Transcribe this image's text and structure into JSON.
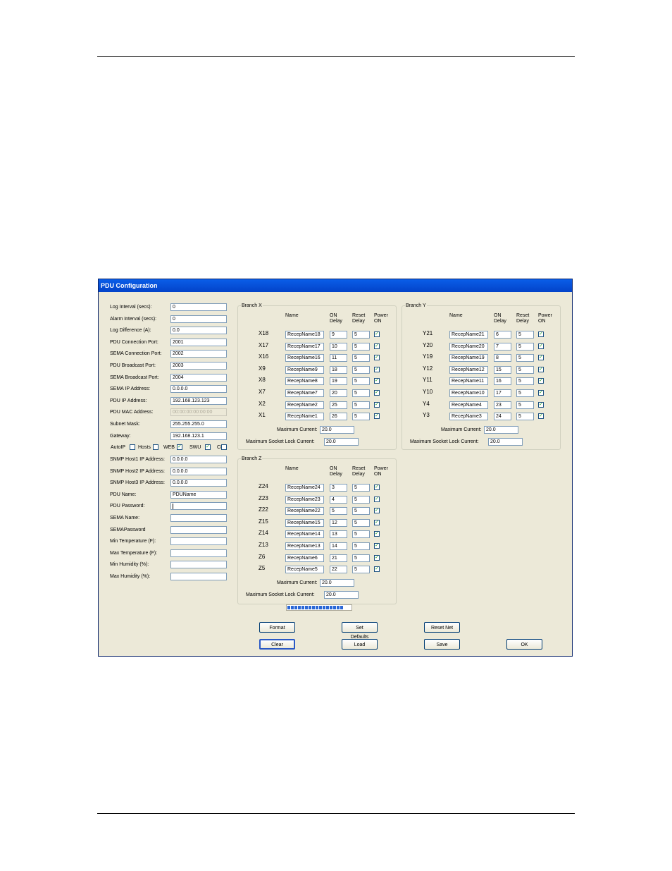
{
  "window": {
    "title": "PDU Configuration"
  },
  "left_fields": [
    {
      "label": "Log Interval (secs):",
      "value": "0",
      "state": "normal"
    },
    {
      "label": "Alarm Interval (secs):",
      "value": "0",
      "state": "normal"
    },
    {
      "label": "Log Difference (A):",
      "value": "0.0",
      "state": "normal"
    },
    {
      "label": "PDU Connection Port:",
      "value": "2001",
      "state": "normal"
    },
    {
      "label": "SEMA Connection Port:",
      "value": "2002",
      "state": "normal"
    },
    {
      "label": "PDU Broadcast Port:",
      "value": "2003",
      "state": "normal"
    },
    {
      "label": "SEMA Broadcast Port:",
      "value": "2004",
      "state": "normal"
    },
    {
      "label": "SEMA IP Address:",
      "value": "0.0.0.0",
      "state": "normal"
    },
    {
      "label": "PDU IP Address:",
      "value": "192.168.123.123",
      "state": "normal"
    },
    {
      "label": "PDU MAC Address:",
      "value": "00:00:00:00:00:00",
      "state": "disabled"
    },
    {
      "label": "Subnet Mask:",
      "value": "255.255.255.0",
      "state": "normal"
    },
    {
      "label": "Gateway:",
      "value": "192.168.123.1",
      "state": "normal"
    }
  ],
  "options": [
    {
      "label": "AutoIP",
      "checked": false
    },
    {
      "label": "Hosts",
      "checked": false
    },
    {
      "label": "WEB",
      "checked": true
    },
    {
      "label": "SWU",
      "checked": true
    },
    {
      "label": "CI",
      "checked": false
    }
  ],
  "left_fields2": [
    {
      "label": "SNMP Host1 IP Address:",
      "value": "0.0.0.0"
    },
    {
      "label": "SNMP Host2 IP Address:",
      "value": "0.0.0.0"
    },
    {
      "label": "SNMP Host3 IP Address:",
      "value": "0.0.0.0"
    },
    {
      "label": "PDU Name:",
      "value": "PDUName"
    },
    {
      "label": "PDU Password:",
      "value": ""
    },
    {
      "label": "SEMA Name:",
      "value": ""
    },
    {
      "label": "SEMAPassword",
      "value": ""
    },
    {
      "label": "Min Temperature (F):",
      "value": ""
    },
    {
      "label": "Max Temperature (F):",
      "value": ""
    },
    {
      "label": "Min Humidity (%):",
      "value": ""
    },
    {
      "label": "Max Humidity (%):",
      "value": ""
    }
  ],
  "column_headers": {
    "name": "Name",
    "on_delay": [
      "ON",
      "Delay"
    ],
    "reset_delay": [
      "Reset",
      "Delay"
    ],
    "power_on": [
      "Power",
      "ON"
    ]
  },
  "branches": [
    {
      "title": "Branch X",
      "rows": [
        {
          "id": "X18",
          "name": "RecepName18",
          "on_delay": "9",
          "reset_delay": "5",
          "power_on": true
        },
        {
          "id": "X17",
          "name": "RecepName17",
          "on_delay": "10",
          "reset_delay": "5",
          "power_on": true
        },
        {
          "id": "X16",
          "name": "RecepName16",
          "on_delay": "11",
          "reset_delay": "5",
          "power_on": true
        },
        {
          "id": "X9",
          "name": "RecepName9",
          "on_delay": "18",
          "reset_delay": "5",
          "power_on": true
        },
        {
          "id": "X8",
          "name": "RecepName8",
          "on_delay": "19",
          "reset_delay": "5",
          "power_on": true
        },
        {
          "id": "X7",
          "name": "RecepName7",
          "on_delay": "20",
          "reset_delay": "5",
          "power_on": true
        },
        {
          "id": "X2",
          "name": "RecepName2",
          "on_delay": "25",
          "reset_delay": "5",
          "power_on": true
        },
        {
          "id": "X1",
          "name": "RecepName1",
          "on_delay": "26",
          "reset_delay": "5",
          "power_on": true
        }
      ],
      "max_current_label": "Maximum Current:",
      "max_current": "20.0",
      "max_lock_label": "Maximum Socket Lock Current:",
      "max_lock": "20.0"
    },
    {
      "title": "Branch Y",
      "rows": [
        {
          "id": "Y21",
          "name": "RecepName21",
          "on_delay": "6",
          "reset_delay": "5",
          "power_on": true
        },
        {
          "id": "Y20",
          "name": "RecepName20",
          "on_delay": "7",
          "reset_delay": "5",
          "power_on": true
        },
        {
          "id": "Y19",
          "name": "RecepName19",
          "on_delay": "8",
          "reset_delay": "5",
          "power_on": true
        },
        {
          "id": "Y12",
          "name": "RecepName12",
          "on_delay": "15",
          "reset_delay": "5",
          "power_on": true
        },
        {
          "id": "Y11",
          "name": "RecepName11",
          "on_delay": "16",
          "reset_delay": "5",
          "power_on": true
        },
        {
          "id": "Y10",
          "name": "RecepName10",
          "on_delay": "17",
          "reset_delay": "5",
          "power_on": true
        },
        {
          "id": "Y4",
          "name": "RecepName4",
          "on_delay": "23",
          "reset_delay": "5",
          "power_on": true
        },
        {
          "id": "Y3",
          "name": "RecepName3",
          "on_delay": "24",
          "reset_delay": "5",
          "power_on": true
        }
      ],
      "max_current_label": "Maximum Current:",
      "max_current": "20.0",
      "max_lock_label": "Maximum Socket Lock Current:",
      "max_lock": "20.0"
    },
    {
      "title": "Branch Z",
      "rows": [
        {
          "id": "Z24",
          "name": "RecepName24",
          "on_delay": "3",
          "reset_delay": "5",
          "power_on": true
        },
        {
          "id": "Z23",
          "name": "RecepName23",
          "on_delay": "4",
          "reset_delay": "5",
          "power_on": true
        },
        {
          "id": "Z22",
          "name": "RecepName22",
          "on_delay": "5",
          "reset_delay": "5",
          "power_on": true
        },
        {
          "id": "Z15",
          "name": "RecepName15",
          "on_delay": "12",
          "reset_delay": "5",
          "power_on": true
        },
        {
          "id": "Z14",
          "name": "RecepName14",
          "on_delay": "13",
          "reset_delay": "5",
          "power_on": true
        },
        {
          "id": "Z13",
          "name": "RecepName13",
          "on_delay": "14",
          "reset_delay": "5",
          "power_on": true
        },
        {
          "id": "Z6",
          "name": "RecepName6",
          "on_delay": "21",
          "reset_delay": "5",
          "power_on": true
        },
        {
          "id": "Z5",
          "name": "RecepName5",
          "on_delay": "22",
          "reset_delay": "5",
          "power_on": true
        }
      ],
      "max_current_label": "Maximum Current:",
      "max_current": "20.0",
      "max_lock_label": "Maximum Socket Lock Current:",
      "max_lock": "20.0"
    }
  ],
  "progress": {
    "segments": 16
  },
  "buttons_row1": [
    "Format",
    "Set Defaults",
    "Reset Net"
  ],
  "buttons_row2": [
    "Clear",
    "Load",
    "Save",
    "OK"
  ],
  "colors": {
    "titlebar": "#0543cf",
    "dialog_bg": "#ece9d8",
    "check": "#21a121",
    "progress": "#2a67d6"
  }
}
